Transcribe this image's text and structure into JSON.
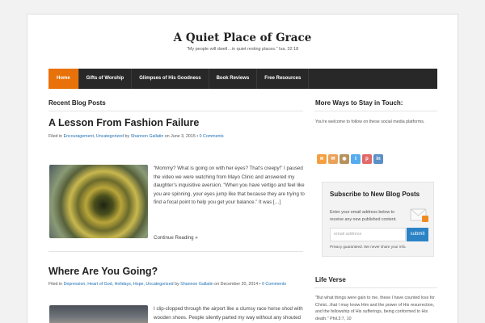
{
  "site": {
    "title": "A Quiet Place of Grace",
    "tagline": "\"My people will dwell…in quiet resting places.\" Isa. 32:18"
  },
  "nav": [
    {
      "label": "Home",
      "active": true
    },
    {
      "label": "Gifts of Worship"
    },
    {
      "label": "Glimpses of His Goodness"
    },
    {
      "label": "Book Reviews"
    },
    {
      "label": "Free Resources"
    }
  ],
  "main": {
    "section_title": "Recent Blog Posts",
    "posts": [
      {
        "title": "A Lesson From Fashion Failure",
        "filed_in": "Filed in",
        "categories": "Encouragement, Uncategorized",
        "by": "by",
        "author": "Shannon Gallatin",
        "on": "on June 3, 2015 •",
        "comments": "0 Comments",
        "excerpt": "“Mommy? What is going on with her eyes? That’s creepy!” I paused the video we were watching from Mayo Clinic and answered my daughter’s inquisitive aversion. “When you have vertigo and feel like you are spinning, your eyes jump like that because they are trying to find a focal point to help you get your balance.” It was […]",
        "continue": "Continue Reading »"
      },
      {
        "title": "Where Are You Going?",
        "filed_in": "Filed in",
        "categories": "Depression, Heart of God, Holidays, Hope, Uncategorized",
        "by": "by",
        "author": "Shannon Gallatin",
        "on": "on December 20, 2014 •",
        "comments": "0 Comments",
        "excerpt": "I clip-clopped through the airport like a clumsy race horse shod with wooden shoes. People silently parted my way without any shouted apologies, horns or red carpet rollouts. My boots were warm but loud enough to"
      }
    ]
  },
  "sidebar": {
    "stay_title": "More Ways to Stay in Touch:",
    "stay_text": "You're welcome to follow on these social media platforms.",
    "social": [
      {
        "icon": "rss-icon",
        "glyph": "≋",
        "color": "#f5a040"
      },
      {
        "icon": "email-icon",
        "glyph": "✉",
        "color": "#e9a25a"
      },
      {
        "icon": "instagram-icon",
        "glyph": "◉",
        "color": "#b8925e"
      },
      {
        "icon": "twitter-icon",
        "glyph": "t",
        "color": "#55acee"
      },
      {
        "icon": "pinterest-icon",
        "glyph": "p",
        "color": "#e06a6a"
      },
      {
        "icon": "linkedin-icon",
        "glyph": "in",
        "color": "#5b8fc7"
      }
    ],
    "subscribe": {
      "title": "Subscribe to New Blog Posts",
      "text": "Enter your email address below to receive any new published content.",
      "placeholder": "email address",
      "button": "submit",
      "privacy": "Privacy guaranteed. We never share your info."
    },
    "verse_title": "Life Verse",
    "verse_text": "\"But what things were gain to me, these I have counted loss for Christ...that I may know Him and the power of His resurrection, and the fellowship of His sufferings, being conformed to His death.\" Phil.3:7, 10"
  }
}
